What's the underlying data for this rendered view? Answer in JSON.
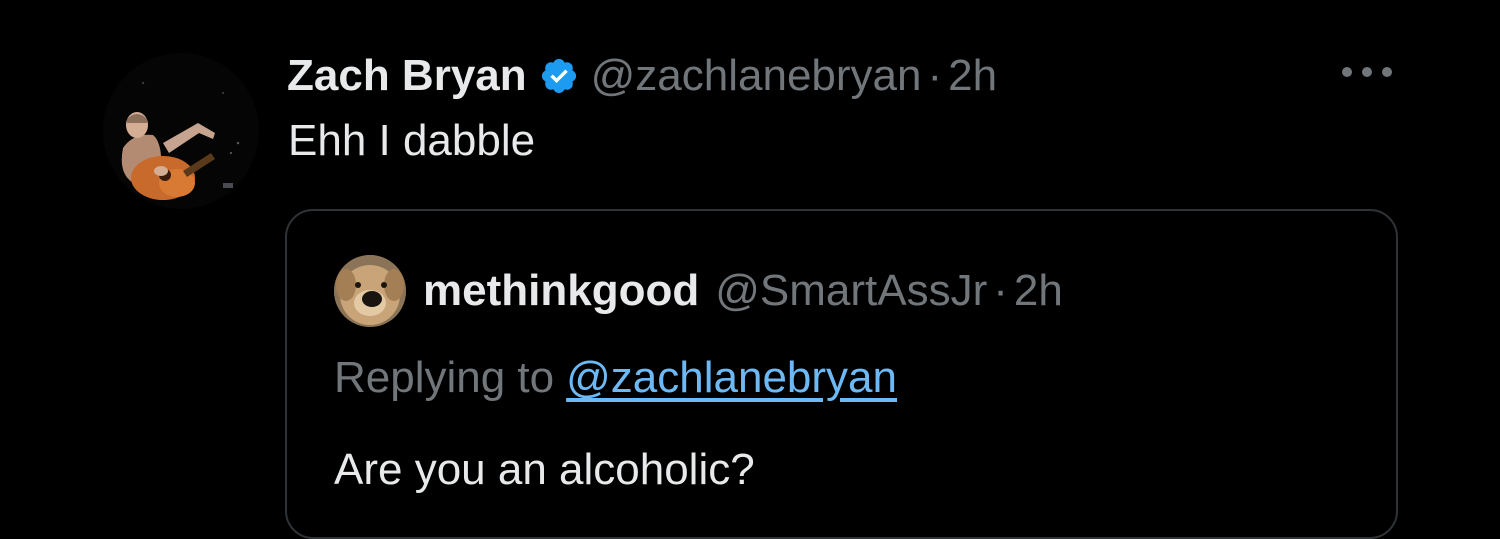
{
  "tweet": {
    "author": {
      "display_name": "Zach Bryan",
      "handle": "@zachlanebryan",
      "verified": true,
      "avatar_icon": "guitarist-avatar"
    },
    "separator": "·",
    "time": "2h",
    "text": "Ehh I dabble",
    "more_icon": "more-dots-icon"
  },
  "quoted_tweet": {
    "author": {
      "display_name": "methinkgood",
      "handle": "@SmartAssJr",
      "avatar_icon": "dog-avatar"
    },
    "separator": "·",
    "time": "2h",
    "replying_label": "Replying to",
    "replying_to": "@zachlanebryan",
    "text": "Are you an alcoholic?"
  },
  "colors": {
    "background": "#000000",
    "primary_text": "#e7e9ea",
    "secondary_text": "#71767b",
    "link": "#6cb9f5",
    "verified_badge": "#1d9bf0",
    "card_border": "#2f3336"
  }
}
